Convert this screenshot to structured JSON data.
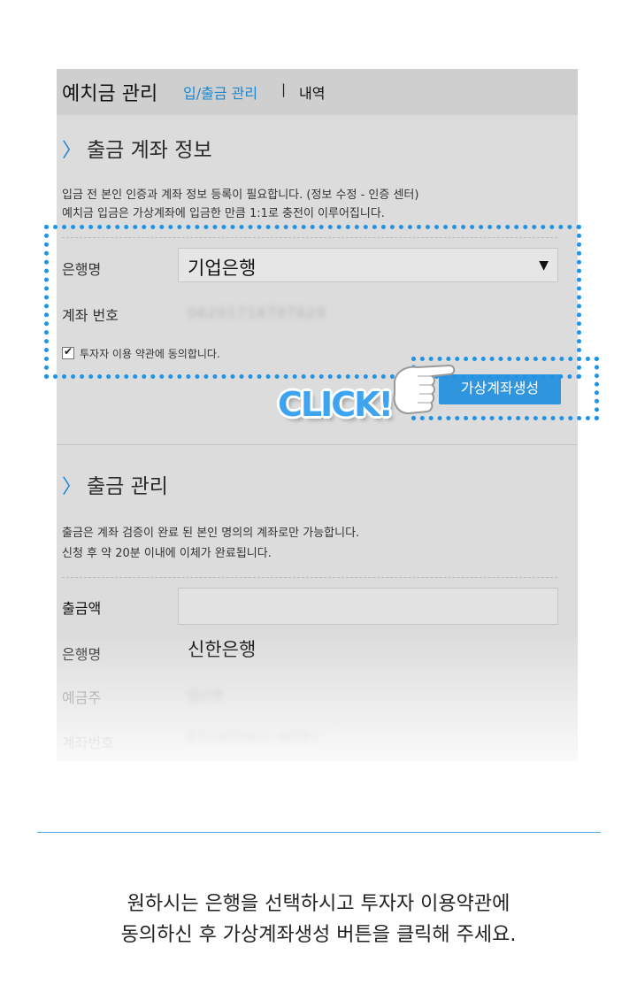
{
  "header": {
    "title": "예치금 관리",
    "tab_active": "입/출금 관리",
    "separator": "|",
    "tab_history": "내역"
  },
  "withdraw_account": {
    "section_title": "출금 계좌 정보",
    "desc_line1": "입금 전 본인 인증과 계좌 정보 등록이 필요합니다. (정보 수정 - 인증 센터)",
    "desc_line2": "예치금 입금은 가상계좌에 입금한 만큼 1:1로 충전이 이루어집니다.",
    "bank_label": "은행명",
    "bank_selected": "기업은행",
    "account_label": "계좌 번호",
    "account_number_blurred": "06201718797629",
    "agree_label": "투자자 이용 약관에 동의합니다.",
    "agree_checked": true,
    "create_button": "가상계좌생성"
  },
  "withdraw_manage": {
    "section_title": "출금 관리",
    "desc_line1": "출금은 계좌 검증이 완료 된 본인 명의의 계좌로만 가능합니다.",
    "desc_line2": "신청 후 약 20분 이내에 이체가 완료됩니다.",
    "amount_label": "출금액",
    "bank_label": "은행명",
    "bank_value": "신한은행",
    "holder_label": "예금주",
    "holder_blurred": "임근호",
    "account_label": "계좌번호",
    "account_blurred": "8772870921 48787"
  },
  "callout": {
    "click_text": "CLICK!"
  },
  "caption": {
    "line1": "원하시는 은행을 선택하시고 투자자 이용약관에",
    "line2": "동의하신 후 가상계좌생성 버튼을 클릭해 주세요."
  },
  "colors": {
    "accent": "#1d86d1",
    "button": "#2f95de",
    "highlight_dots": "#1f93e6"
  }
}
